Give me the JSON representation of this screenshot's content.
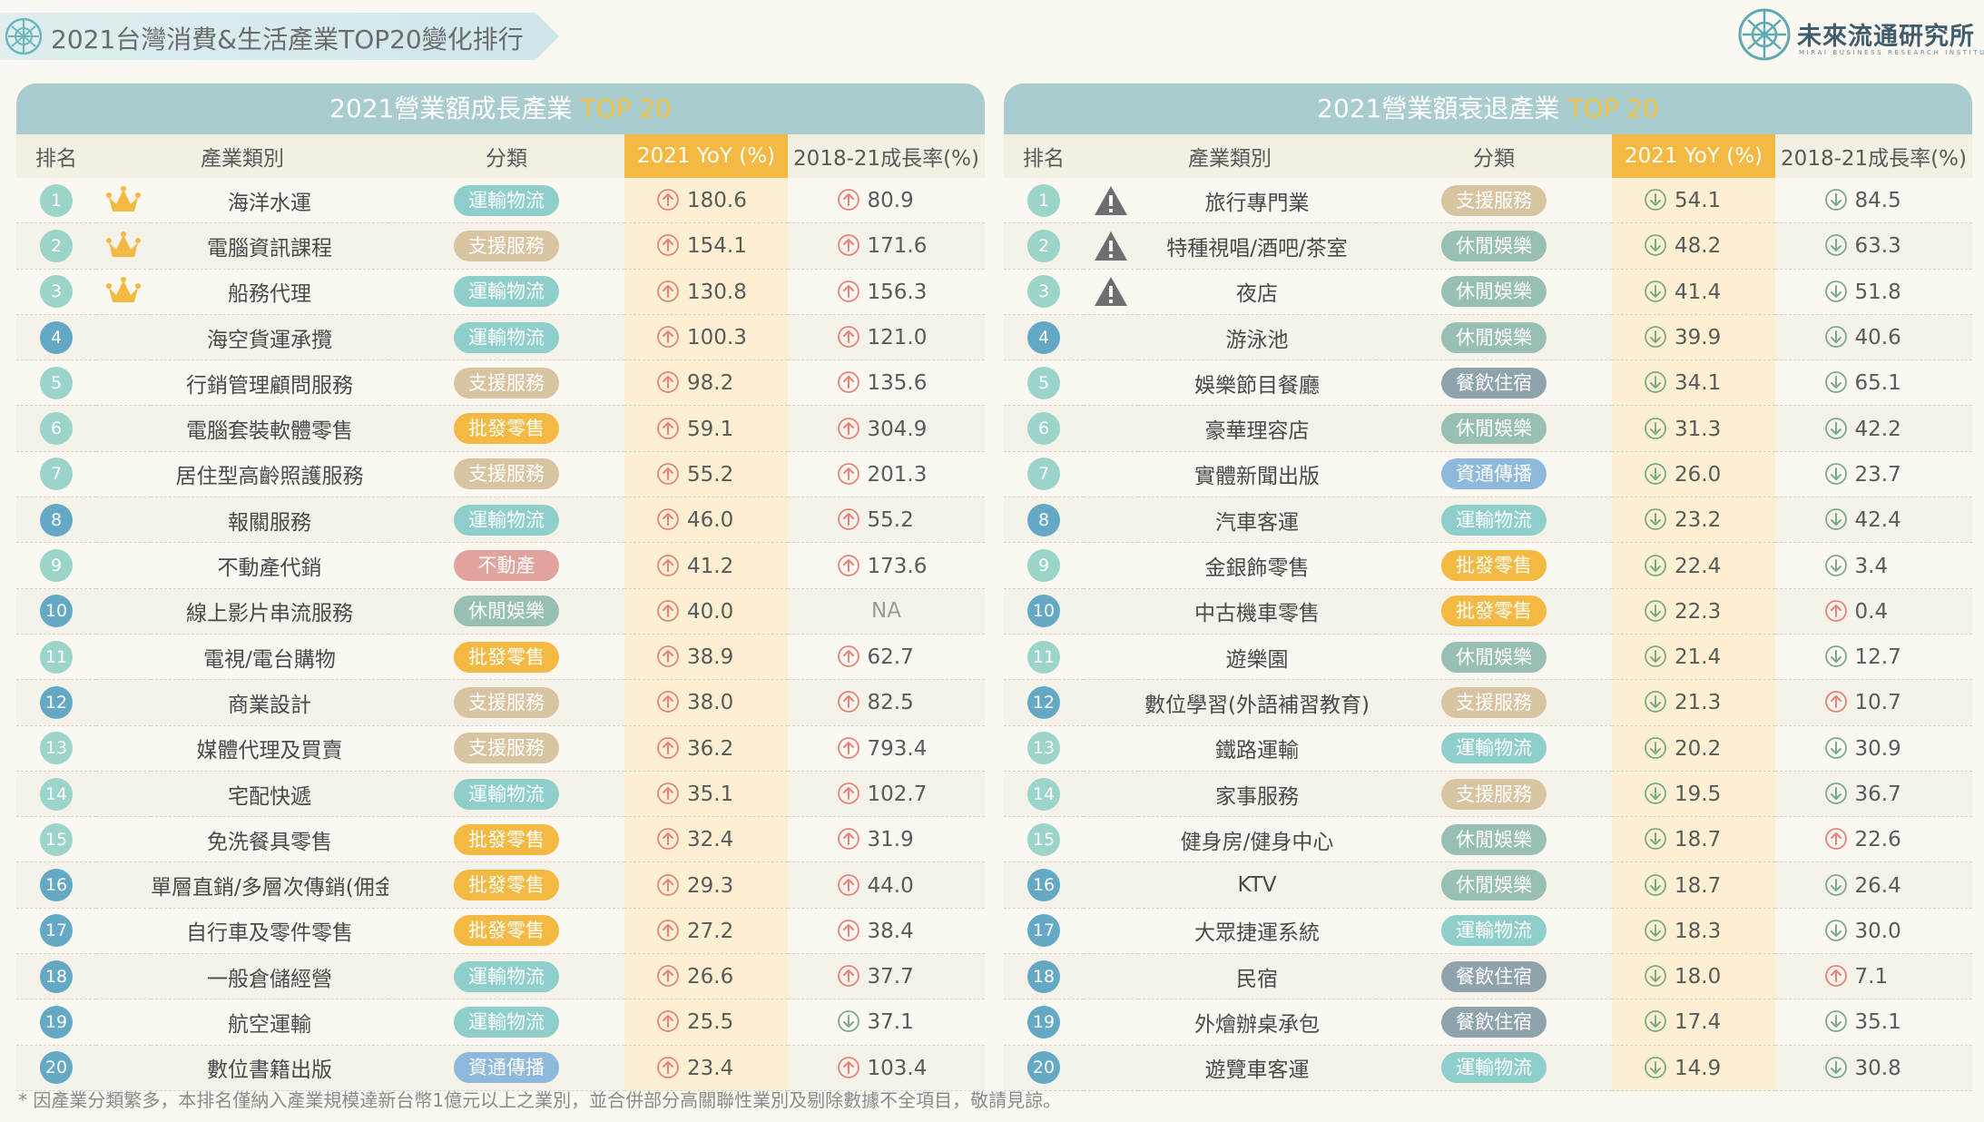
{
  "title": "2021台灣消費&生活產業TOP20變化排行",
  "brand": {
    "name": "未來流通研究所",
    "sub": "MIRAI BUSINESS RESEARCH INSTITUTE"
  },
  "colors": {
    "運輸物流": "#8fcfcb",
    "支援服務": "#d9c4a2",
    "批發零售": "#f4b942",
    "不動產": "#e0a49c",
    "休閒娛樂": "#97bfb3",
    "資通傳播": "#8fb9dc",
    "餐飲住宿": "#8fa3ad",
    "arrow_up": "#e8827a",
    "arrow_down": "#7aaa88"
  },
  "left": {
    "heading": "2021營業額成長產業",
    "heading_hl": "TOP 20",
    "headers": {
      "rank": "排名",
      "name": "產業類別",
      "cat": "分類",
      "yoy": "2021 YoY (%)",
      "g": "2018-21成長率(%)"
    },
    "rows": [
      {
        "rank": "1",
        "icon": "crown-icon",
        "name": "海洋水運",
        "cat": "運輸物流",
        "yoy": "180.6",
        "yd": "up",
        "g": "80.9",
        "gd": "up"
      },
      {
        "rank": "2",
        "icon": "crown-icon",
        "name": "電腦資訊課程",
        "cat": "支援服務",
        "yoy": "154.1",
        "yd": "up",
        "g": "171.6",
        "gd": "up"
      },
      {
        "rank": "3",
        "icon": "crown-icon",
        "name": "船務代理",
        "cat": "運輸物流",
        "yoy": "130.8",
        "yd": "up",
        "g": "156.3",
        "gd": "up"
      },
      {
        "rank": "4",
        "icon": "",
        "name": "海空貨運承攬",
        "cat": "運輸物流",
        "yoy": "100.3",
        "yd": "up",
        "g": "121.0",
        "gd": "up"
      },
      {
        "rank": "5",
        "icon": "",
        "name": "行銷管理顧問服務",
        "cat": "支援服務",
        "yoy": "98.2",
        "yd": "up",
        "g": "135.6",
        "gd": "up"
      },
      {
        "rank": "6",
        "icon": "",
        "name": "電腦套裝軟體零售",
        "cat": "批發零售",
        "yoy": "59.1",
        "yd": "up",
        "g": "304.9",
        "gd": "up"
      },
      {
        "rank": "7",
        "icon": "",
        "name": "居住型高齡照護服務",
        "cat": "支援服務",
        "yoy": "55.2",
        "yd": "up",
        "g": "201.3",
        "gd": "up"
      },
      {
        "rank": "8",
        "icon": "",
        "name": "報關服務",
        "cat": "運輸物流",
        "yoy": "46.0",
        "yd": "up",
        "g": "55.2",
        "gd": "up"
      },
      {
        "rank": "9",
        "icon": "",
        "name": "不動產代銷",
        "cat": "不動產",
        "yoy": "41.2",
        "yd": "up",
        "g": "173.6",
        "gd": "up"
      },
      {
        "rank": "10",
        "icon": "",
        "name": "線上影片串流服務",
        "cat": "休閒娛樂",
        "yoy": "40.0",
        "yd": "up",
        "g": "NA",
        "gd": ""
      },
      {
        "rank": "11",
        "icon": "",
        "name": "電視/電台購物",
        "cat": "批發零售",
        "yoy": "38.9",
        "yd": "up",
        "g": "62.7",
        "gd": "up"
      },
      {
        "rank": "12",
        "icon": "",
        "name": "商業設計",
        "cat": "支援服務",
        "yoy": "38.0",
        "yd": "up",
        "g": "82.5",
        "gd": "up"
      },
      {
        "rank": "13",
        "icon": "",
        "name": "媒體代理及買賣",
        "cat": "支援服務",
        "yoy": "36.2",
        "yd": "up",
        "g": "793.4",
        "gd": "up"
      },
      {
        "rank": "14",
        "icon": "",
        "name": "宅配快遞",
        "cat": "運輸物流",
        "yoy": "35.1",
        "yd": "up",
        "g": "102.7",
        "gd": "up"
      },
      {
        "rank": "15",
        "icon": "",
        "name": "免洗餐具零售",
        "cat": "批發零售",
        "yoy": "32.4",
        "yd": "up",
        "g": "31.9",
        "gd": "up"
      },
      {
        "rank": "16",
        "icon": "",
        "name": "單層直銷/多層次傳銷(佣金收入)",
        "cat": "批發零售",
        "yoy": "29.3",
        "yd": "up",
        "g": "44.0",
        "gd": "up"
      },
      {
        "rank": "17",
        "icon": "",
        "name": "自行車及零件零售",
        "cat": "批發零售",
        "yoy": "27.2",
        "yd": "up",
        "g": "38.4",
        "gd": "up"
      },
      {
        "rank": "18",
        "icon": "",
        "name": "一般倉儲經營",
        "cat": "運輸物流",
        "yoy": "26.6",
        "yd": "up",
        "g": "37.7",
        "gd": "up"
      },
      {
        "rank": "19",
        "icon": "",
        "name": "航空運輸",
        "cat": "運輸物流",
        "yoy": "25.5",
        "yd": "up",
        "g": "37.1",
        "gd": "down"
      },
      {
        "rank": "20",
        "icon": "",
        "name": "數位書籍出版",
        "cat": "資通傳播",
        "yoy": "23.4",
        "yd": "up",
        "g": "103.4",
        "gd": "up"
      }
    ]
  },
  "right": {
    "heading": "2021營業額衰退產業",
    "heading_hl": "TOP 20",
    "headers": {
      "rank": "排名",
      "name": "產業類別",
      "cat": "分類",
      "yoy": "2021 YoY (%)",
      "g": "2018-21成長率(%)"
    },
    "rows": [
      {
        "rank": "1",
        "icon": "warning-icon",
        "name": "旅行專門業",
        "cat": "支援服務",
        "yoy": "54.1",
        "yd": "down",
        "g": "84.5",
        "gd": "down"
      },
      {
        "rank": "2",
        "icon": "warning-icon",
        "name": "特種視唱/酒吧/茶室",
        "cat": "休閒娛樂",
        "yoy": "48.2",
        "yd": "down",
        "g": "63.3",
        "gd": "down"
      },
      {
        "rank": "3",
        "icon": "warning-icon",
        "name": "夜店",
        "cat": "休閒娛樂",
        "yoy": "41.4",
        "yd": "down",
        "g": "51.8",
        "gd": "down"
      },
      {
        "rank": "4",
        "icon": "",
        "name": "游泳池",
        "cat": "休閒娛樂",
        "yoy": "39.9",
        "yd": "down",
        "g": "40.6",
        "gd": "down"
      },
      {
        "rank": "5",
        "icon": "",
        "name": "娛樂節目餐廳",
        "cat": "餐飲住宿",
        "yoy": "34.1",
        "yd": "down",
        "g": "65.1",
        "gd": "down"
      },
      {
        "rank": "6",
        "icon": "",
        "name": "豪華理容店",
        "cat": "休閒娛樂",
        "yoy": "31.3",
        "yd": "down",
        "g": "42.2",
        "gd": "down"
      },
      {
        "rank": "7",
        "icon": "",
        "name": "實體新聞出版",
        "cat": "資通傳播",
        "yoy": "26.0",
        "yd": "down",
        "g": "23.7",
        "gd": "down"
      },
      {
        "rank": "8",
        "icon": "",
        "name": "汽車客運",
        "cat": "運輸物流",
        "yoy": "23.2",
        "yd": "down",
        "g": "42.4",
        "gd": "down"
      },
      {
        "rank": "9",
        "icon": "",
        "name": "金銀飾零售",
        "cat": "批發零售",
        "yoy": "22.4",
        "yd": "down",
        "g": "3.4",
        "gd": "down"
      },
      {
        "rank": "10",
        "icon": "",
        "name": "中古機車零售",
        "cat": "批發零售",
        "yoy": "22.3",
        "yd": "down",
        "g": "0.4",
        "gd": "up"
      },
      {
        "rank": "11",
        "icon": "",
        "name": "遊樂園",
        "cat": "休閒娛樂",
        "yoy": "21.4",
        "yd": "down",
        "g": "12.7",
        "gd": "down"
      },
      {
        "rank": "12",
        "icon": "",
        "name": "數位學習(外語補習教育)",
        "cat": "支援服務",
        "yoy": "21.3",
        "yd": "down",
        "g": "10.7",
        "gd": "up"
      },
      {
        "rank": "13",
        "icon": "",
        "name": "鐵路運輸",
        "cat": "運輸物流",
        "yoy": "20.2",
        "yd": "down",
        "g": "30.9",
        "gd": "down"
      },
      {
        "rank": "14",
        "icon": "",
        "name": "家事服務",
        "cat": "支援服務",
        "yoy": "19.5",
        "yd": "down",
        "g": "36.7",
        "gd": "down"
      },
      {
        "rank": "15",
        "icon": "",
        "name": "健身房/健身中心",
        "cat": "休閒娛樂",
        "yoy": "18.7",
        "yd": "down",
        "g": "22.6",
        "gd": "up"
      },
      {
        "rank": "16",
        "icon": "",
        "name": "KTV",
        "cat": "休閒娛樂",
        "yoy": "18.7",
        "yd": "down",
        "g": "26.4",
        "gd": "down"
      },
      {
        "rank": "17",
        "icon": "",
        "name": "大眾捷運系統",
        "cat": "運輸物流",
        "yoy": "18.3",
        "yd": "down",
        "g": "30.0",
        "gd": "down"
      },
      {
        "rank": "18",
        "icon": "",
        "name": "民宿",
        "cat": "餐飲住宿",
        "yoy": "18.0",
        "yd": "down",
        "g": "7.1",
        "gd": "up"
      },
      {
        "rank": "19",
        "icon": "",
        "name": "外燴辦桌承包",
        "cat": "餐飲住宿",
        "yoy": "17.4",
        "yd": "down",
        "g": "35.1",
        "gd": "down"
      },
      {
        "rank": "20",
        "icon": "",
        "name": "遊覽車客運",
        "cat": "運輸物流",
        "yoy": "14.9",
        "yd": "down",
        "g": "30.8",
        "gd": "down"
      }
    ]
  },
  "footnote": "* 因產業分類繁多，本排名僅納入產業規模達新台幣1億元以上之業別，並合併部分高關聯性業別及剔除數據不全項目，敬請見諒。"
}
